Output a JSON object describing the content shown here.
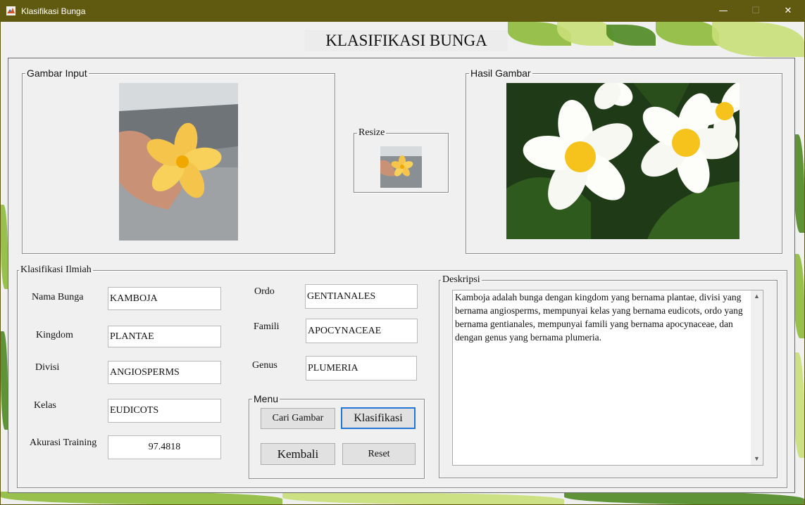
{
  "window": {
    "title": "Klasifikasi Bunga",
    "minimize": "—",
    "maximize": "☐",
    "close": "✕"
  },
  "app_title": "KLASIFIKASI BUNGA",
  "panels": {
    "input_image": "Gambar Input",
    "result_image": "Hasil Gambar",
    "resize": "Resize",
    "scientific": "Klasifikasi Ilmiah",
    "description": "Deskripsi",
    "menu": "Menu"
  },
  "fields": {
    "nama_bunga": {
      "label": "Nama Bunga",
      "value": "KAMBOJA"
    },
    "kingdom": {
      "label": "Kingdom",
      "value": "PLANTAE"
    },
    "divisi": {
      "label": "Divisi",
      "value": "ANGIOSPERMS"
    },
    "kelas": {
      "label": "Kelas",
      "value": "EUDICOTS"
    },
    "akurasi": {
      "label": "Akurasi Training",
      "value": "97.4818"
    },
    "ordo": {
      "label": "Ordo",
      "value": "GENTIANALES"
    },
    "famili": {
      "label": "Famili",
      "value": "APOCYNACEAE"
    },
    "genus": {
      "label": "Genus",
      "value": "PLUMERIA"
    }
  },
  "buttons": {
    "cari_gambar": "Cari Gambar",
    "klasifikasi": "Klasifikasi",
    "kembali": "Kembali",
    "reset": "Reset"
  },
  "description_text": "Kamboja adalah bunga dengan kingdom yang bernama plantae, divisi yang bernama angiosperms, mempunyai kelas yang bernama eudicots, ordo yang bernama gentianales, mempunyai famili yang bernama apocynaceae, dan dengan genus yang bernama plumeria.",
  "colors": {
    "titlebar": "#5f5a10",
    "focus": "#2277d6",
    "leaf": "#8dbb3a",
    "flower_yellow": "#f6c21c"
  }
}
